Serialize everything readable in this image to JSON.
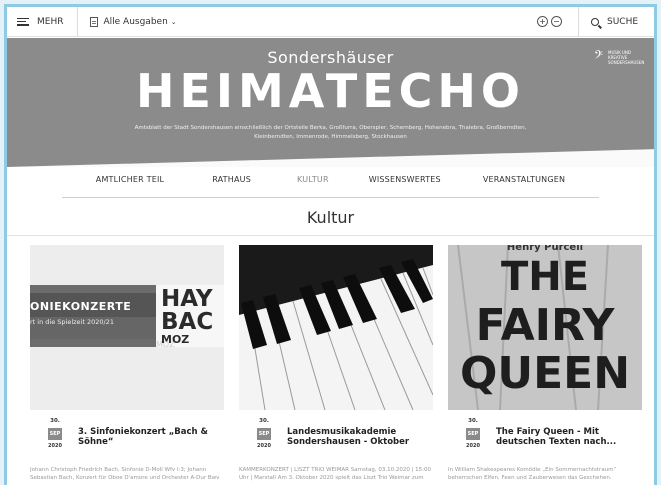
{
  "topbar": {
    "menu_label": "MEHR",
    "editions_label": "Alle Ausgaben",
    "zoom_in": "+",
    "zoom_out": "−",
    "search_label": "SUCHE"
  },
  "banner": {
    "top_line": "Sondershäuser",
    "title": "HEIMATECHO",
    "subtitle": "Amtsblatt der Stadt Sondershausen einschließlich der Ortsteile Berka, Großfurra, Oberspier, Schernberg, Hohenebra, Thalebra, Großberndten, Kleinberndten, Immenrode, Himmelsberg, Stockhausen",
    "logo_text": "MUSIK UND KREATIVE SONDERSHAUSEN"
  },
  "nav": {
    "items": [
      {
        "label": "AMTLICHER TEIL",
        "active": false
      },
      {
        "label": "RATHAUS",
        "active": false
      },
      {
        "label": "KULTUR",
        "active": true
      },
      {
        "label": "WISSENSWERTES",
        "active": false
      },
      {
        "label": "VERANSTALTUNGEN",
        "active": false
      }
    ]
  },
  "section": {
    "title": "Kultur"
  },
  "cards": [
    {
      "day": "30.",
      "month": "SEP",
      "year": "2020",
      "title": "3. Sinfoniekonzert „Bach & Söhne“",
      "text": "Johann Christoph Friedrich Bach, Sinfonie D-Moll Wfv I:3; Johann Sebastian Bach, Konzert für Oboe D'amore und Orchester A-Dur Bwv 1055r Johann",
      "image": {
        "line1": "ONIEKONZERTE",
        "line2": "rt in die Spielzeit 2020/21",
        "side1": "HAY",
        "side2": "BAC",
        "side3": "MOZ"
      }
    },
    {
      "day": "30.",
      "month": "SEP",
      "year": "2020",
      "title": "Landesmusikakademie Sondershausen - Oktober",
      "text": "KAMMERKONZERT | LISZT TRIO WEIMAR Samstag, 03.10.2020 | 15:00 Uhr | Marstall Am 3. Oktober 2020 spielt das Liszt Trio Weimar zum 250. Geburtstag"
    },
    {
      "day": "30.",
      "month": "SEP",
      "year": "2020",
      "title": "The Fairy Queen - Mit deutschen Texten nach...",
      "text": "In William Shakespeares Komödie „Ein Sommernachtstraum“ beherrschen Elfen, Feen und Zauberwesen das Geschehen. Verzaubernde Geschichten",
      "image": {
        "author": "Henry Purcell",
        "line1": "THE",
        "line2": "FAIRY",
        "line3": "QUEEN"
      }
    }
  ],
  "colors": {
    "frame": "#8ccae6",
    "banner": "#8b8b8b",
    "badge": "#8a8a8a"
  }
}
